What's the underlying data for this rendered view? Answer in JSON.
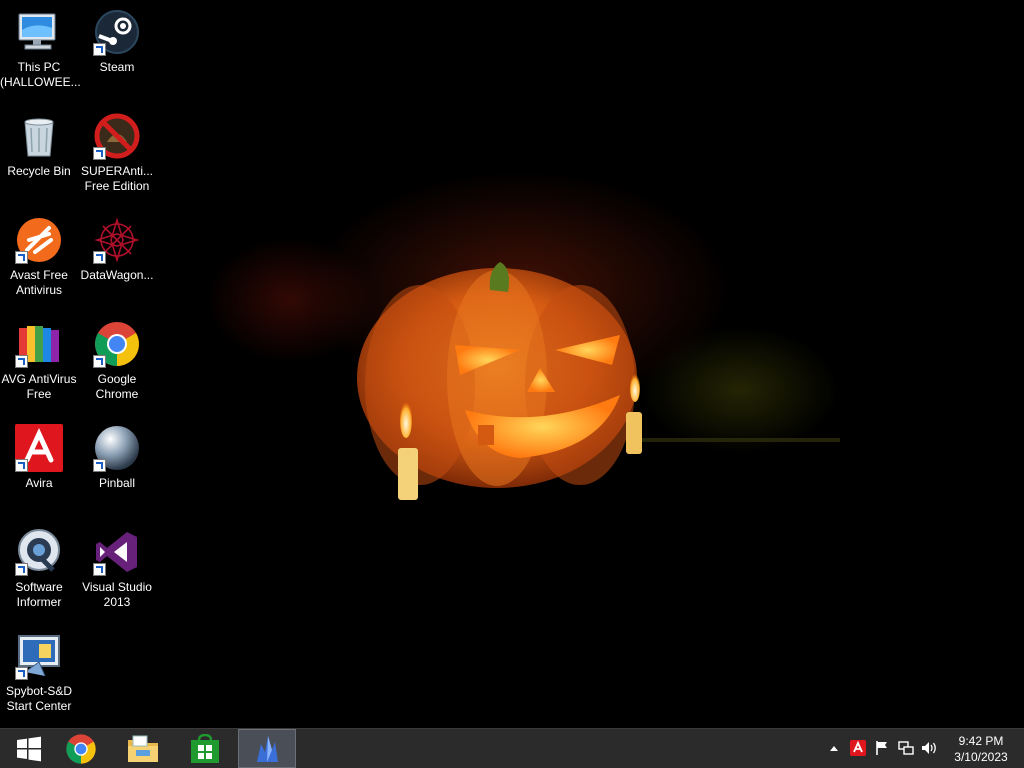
{
  "desktop": {
    "icons": [
      {
        "label": "This PC\n(HALLOWEE...",
        "icon": "this-pc-icon",
        "shortcut": false
      },
      {
        "label": "Steam",
        "icon": "steam-icon",
        "shortcut": true
      },
      {
        "label": "Recycle Bin",
        "icon": "recycle-bin-icon",
        "shortcut": false
      },
      {
        "label": "SUPERAnti...\nFree Edition",
        "icon": "superantispyware-icon",
        "shortcut": true
      },
      {
        "label": "Avast Free\nAntivirus",
        "icon": "avast-icon",
        "shortcut": true
      },
      {
        "label": "DataWagon...",
        "icon": "datawagon-icon",
        "shortcut": true
      },
      {
        "label": "AVG AntiVirus\nFree",
        "icon": "avg-icon",
        "shortcut": true
      },
      {
        "label": "Google\nChrome",
        "icon": "chrome-icon",
        "shortcut": true
      },
      {
        "label": "Avira",
        "icon": "avira-icon",
        "shortcut": true
      },
      {
        "label": "Pinball",
        "icon": "pinball-icon",
        "shortcut": true
      },
      {
        "label": "Software\nInformer",
        "icon": "software-informer-icon",
        "shortcut": true
      },
      {
        "label": "Visual Studio\n2013",
        "icon": "visual-studio-icon",
        "shortcut": true
      },
      {
        "label": "Spybot-S&D\nStart Center",
        "icon": "spybot-icon",
        "shortcut": true
      }
    ]
  },
  "taskbar": {
    "buttons": [
      {
        "name": "start-button",
        "icon": "windows-logo-icon"
      },
      {
        "name": "chrome-taskbar-button",
        "icon": "chrome-icon"
      },
      {
        "name": "file-explorer-taskbar-button",
        "icon": "folder-icon"
      },
      {
        "name": "store-taskbar-button",
        "icon": "store-icon"
      },
      {
        "name": "app-taskbar-button",
        "icon": "crystal-app-icon",
        "active": true
      }
    ],
    "tray": {
      "icons": [
        "chevron-up-icon",
        "avira-tray-icon",
        "flag-icon",
        "network-icon",
        "volume-icon"
      ]
    },
    "clock": {
      "time": "9:42 PM",
      "date": "3/10/2023"
    }
  },
  "colors": {
    "taskbar": "#2b2b2b",
    "active_button": "#4a4f57",
    "pumpkin": "#e0681c"
  }
}
